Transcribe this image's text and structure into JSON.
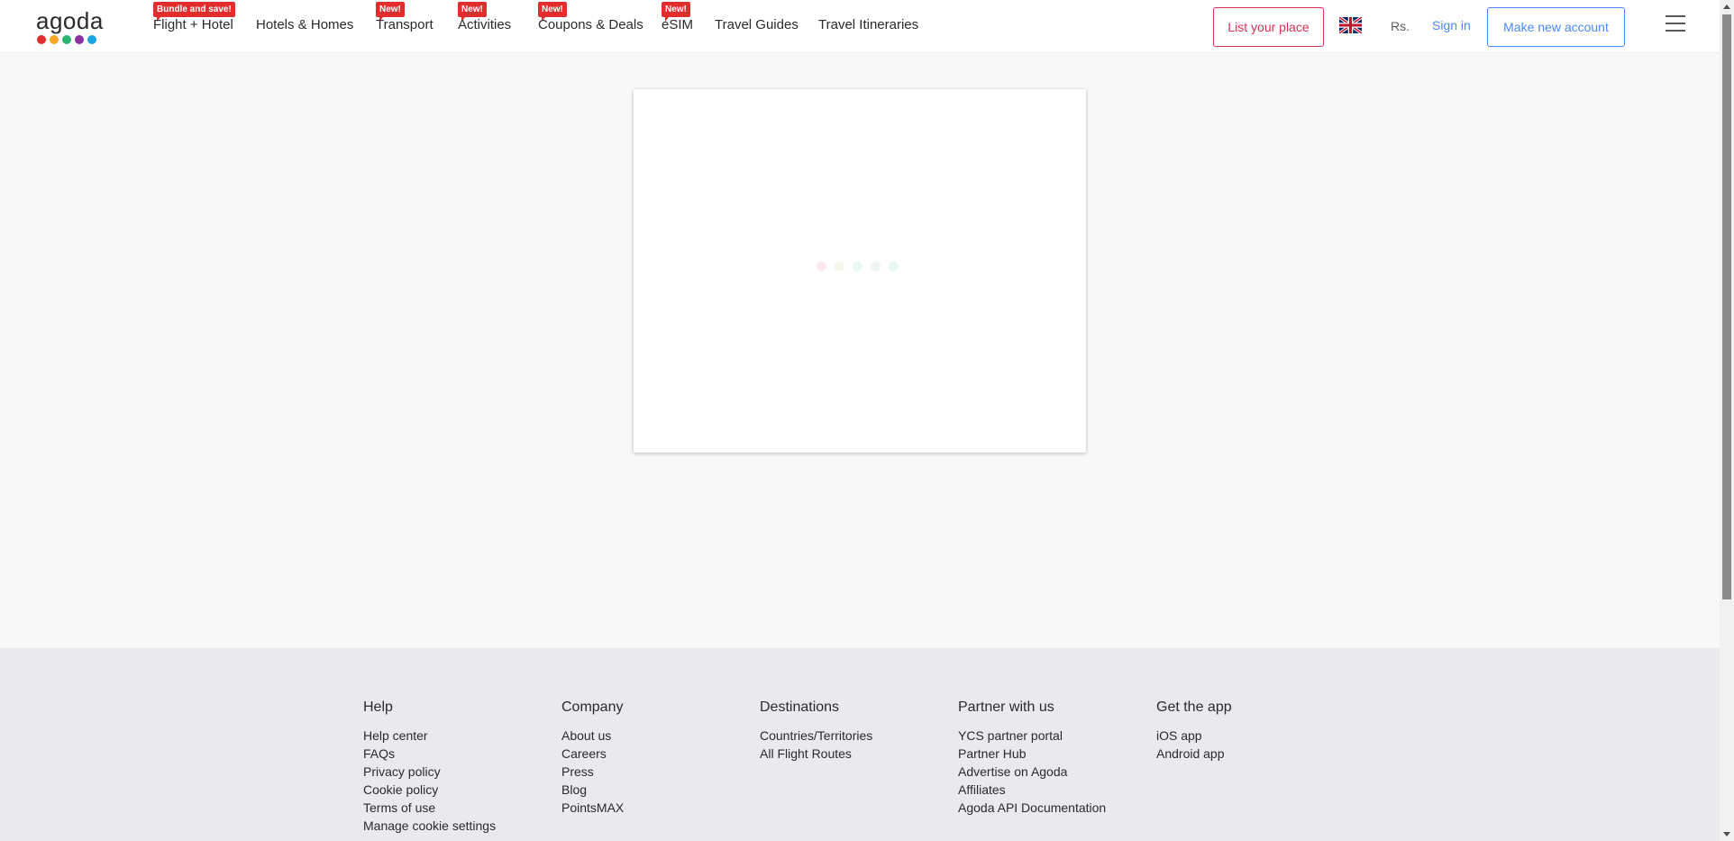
{
  "header": {
    "logo_text": "agoda",
    "logo_dot_colors": [
      "#e12d2d",
      "#f6a623",
      "#2bb673",
      "#8b2fa1",
      "#1ba4e4"
    ],
    "nav": [
      {
        "label": "Flight + Hotel",
        "badge": "Bundle and save!"
      },
      {
        "label": "Hotels & Homes",
        "badge": ""
      },
      {
        "label": "Transport",
        "badge": "New!"
      },
      {
        "label": "Activities",
        "badge": "New!"
      },
      {
        "label": "Coupons & Deals",
        "badge": "New!"
      },
      {
        "label": "eSIM",
        "badge": "New!"
      },
      {
        "label": "Travel Guides",
        "badge": ""
      },
      {
        "label": "Travel Itineraries",
        "badge": ""
      }
    ],
    "list_place_label": "List your place",
    "language_icon": "uk-flag-icon",
    "currency": "Rs.",
    "sign_in_label": "Sign in",
    "create_account_label": "Make new account",
    "menu_icon": "hamburger-menu-icon",
    "accent_color": "#e12d55",
    "link_color": "#488bf8"
  },
  "main": {
    "loader_icon": "loading-dots-icon"
  },
  "footer": {
    "columns": [
      {
        "title": "Help",
        "links": [
          "Help center",
          "FAQs",
          "Privacy policy",
          "Cookie policy",
          "Terms of use",
          "Manage cookie settings"
        ]
      },
      {
        "title": "Company",
        "links": [
          "About us",
          "Careers",
          "Press",
          "Blog",
          "PointsMAX"
        ]
      },
      {
        "title": "Destinations",
        "links": [
          "Countries/Territories",
          "All Flight Routes"
        ]
      },
      {
        "title": "Partner with us",
        "links": [
          "YCS partner portal",
          "Partner Hub",
          "Advertise on Agoda",
          "Affiliates",
          "Agoda API Documentation"
        ]
      },
      {
        "title": "Get the app",
        "links": [
          "iOS app",
          "Android app"
        ]
      }
    ]
  }
}
